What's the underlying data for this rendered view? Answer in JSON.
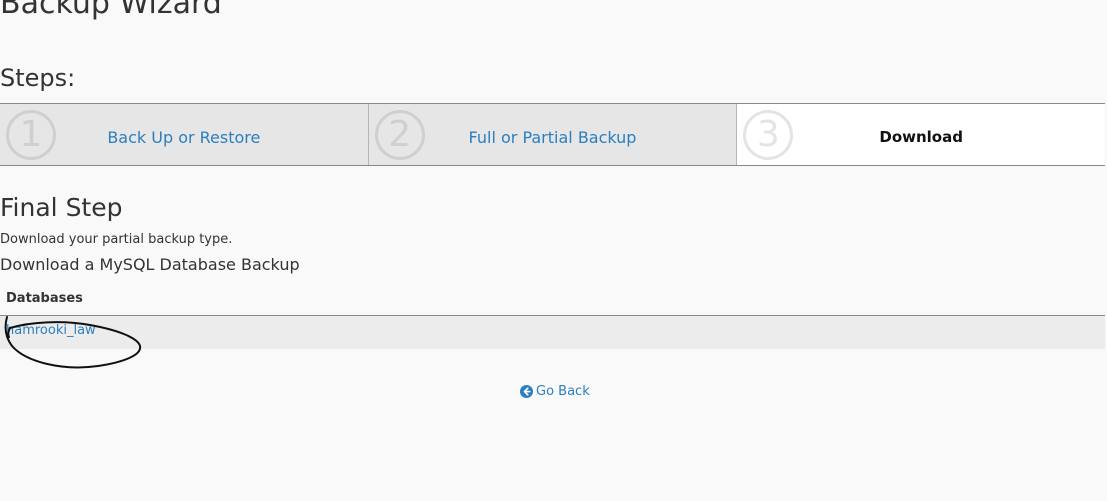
{
  "page": {
    "title": "Backup Wizard"
  },
  "steps": {
    "heading": "Steps:",
    "items": [
      {
        "number": "1",
        "label": "Back Up or Restore",
        "active": false
      },
      {
        "number": "2",
        "label": "Full or Partial Backup",
        "active": false
      },
      {
        "number": "3",
        "label": "Download",
        "active": true
      }
    ]
  },
  "final_step": {
    "title": "Final Step",
    "description": "Download your partial backup type.",
    "subtitle": "Download a MySQL Database Backup"
  },
  "databases": {
    "header": "Databases",
    "rows": [
      {
        "name": "hamrooki_law"
      }
    ]
  },
  "go_back": {
    "label": "Go Back",
    "icon": "arrow-circle-left-icon"
  },
  "colors": {
    "link": "#2b7fc0",
    "inactive_step_bg": "#e6e6e6",
    "active_step_bg": "#ffffff",
    "page_bg": "#f9f9f9"
  }
}
